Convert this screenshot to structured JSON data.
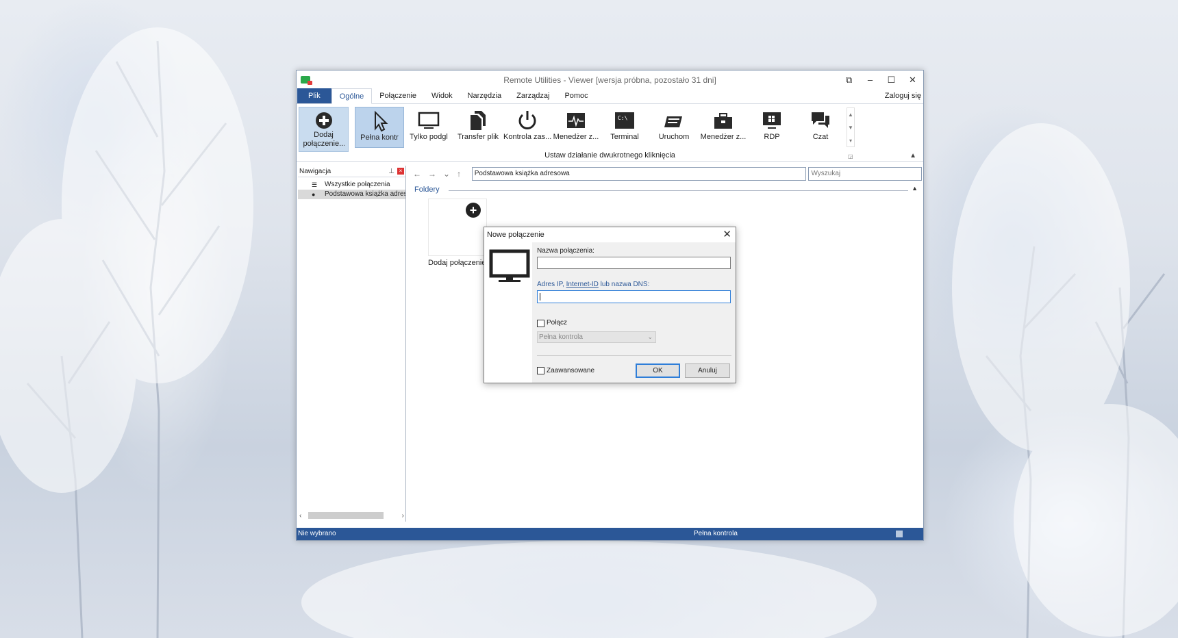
{
  "window": {
    "title": "Remote Utilities - Viewer [wersja próbna, pozostało 31 dni]",
    "controls": {
      "restore": "⧉",
      "minimize": "–",
      "maximize": "☐",
      "close": "✕"
    }
  },
  "tabs": {
    "file": "Plik",
    "items": [
      "Ogólne",
      "Połączenie",
      "Widok",
      "Narzędzia",
      "Zarządzaj",
      "Pomoc"
    ],
    "active": "Ogólne",
    "login": "Zaloguj się"
  },
  "ribbon": {
    "add_label": "Dodaj połączenie...",
    "buttons": [
      {
        "label": "Pełna kontr",
        "icon": "cursor-icon",
        "selected": true
      },
      {
        "label": "Tylko podgl",
        "icon": "monitor-icon"
      },
      {
        "label": "Transfer plik",
        "icon": "files-icon"
      },
      {
        "label": "Kontrola zas...",
        "icon": "power-icon"
      },
      {
        "label": "Menedżer z...",
        "icon": "task-manager-icon"
      },
      {
        "label": "Terminal",
        "icon": "terminal-icon"
      },
      {
        "label": "Uruchom",
        "icon": "run-icon"
      },
      {
        "label": "Menedżer z...",
        "icon": "device-manager-icon"
      },
      {
        "label": "RDP",
        "icon": "rdp-icon"
      },
      {
        "label": "Czat",
        "icon": "chat-icon"
      }
    ],
    "group_label": "Ustaw działanie dwukrotnego kliknięcia"
  },
  "nav": {
    "title": "Nawigacja",
    "items": [
      {
        "label": "Wszystkie połączenia",
        "icon": "list-icon"
      },
      {
        "label": "Podstawowa książka adresowa",
        "icon": "dot-icon",
        "selected": true
      }
    ]
  },
  "address": {
    "path": "Podstawowa książka adresowa",
    "search_placeholder": "Wyszukaj"
  },
  "content": {
    "section": "Foldery",
    "tile_label": "Dodaj połączenie..."
  },
  "status": {
    "left": "Nie wybrano",
    "mode": "Pełna kontrola"
  },
  "dialog": {
    "title": "Nowe połączenie",
    "name_label": "Nazwa połączenia:",
    "name_value": "",
    "ip_label_pre": "Adres IP, ",
    "ip_label_link": "Internet-ID",
    "ip_label_post": " lub nazwa DNS:",
    "ip_value": "",
    "connect_label": "Połącz",
    "mode_value": "Pełna kontrola",
    "advanced_label": "Zaawansowane",
    "ok_label": "OK",
    "cancel_label": "Anuluj"
  }
}
